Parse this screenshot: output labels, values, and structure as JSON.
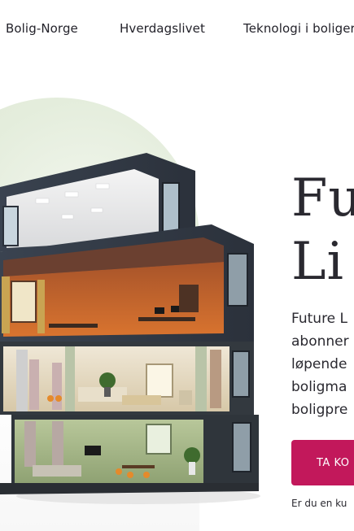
{
  "nav": {
    "items": [
      {
        "label": "Bolig-Norge"
      },
      {
        "label": "Hverdagslivet"
      },
      {
        "label": "Teknologi i boliger"
      }
    ]
  },
  "hero": {
    "title_lines": [
      "Fu",
      "Li"
    ],
    "intro_lines": [
      "Future L",
      "abonner",
      "løpende",
      "boligma",
      "boligpre"
    ],
    "cta_label": "TA KO",
    "sub_link": "Er du en ku"
  },
  "colors": {
    "accent": "#c2185b",
    "text": "#2a2930",
    "backdrop": "#e4eddc"
  },
  "illustration": {
    "icon": "house-cutaway-illustration"
  }
}
